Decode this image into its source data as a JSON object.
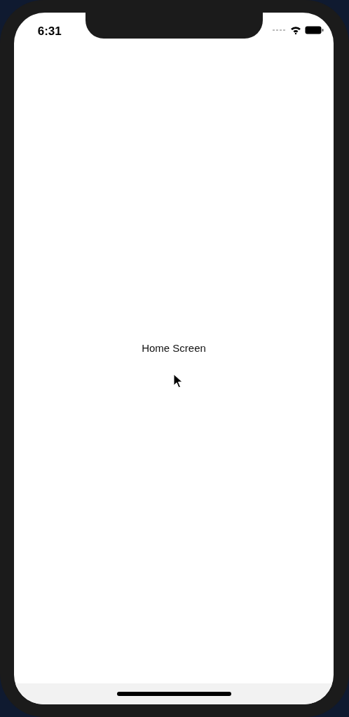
{
  "status_bar": {
    "time": "6:31"
  },
  "screen": {
    "title": "Home Screen"
  }
}
